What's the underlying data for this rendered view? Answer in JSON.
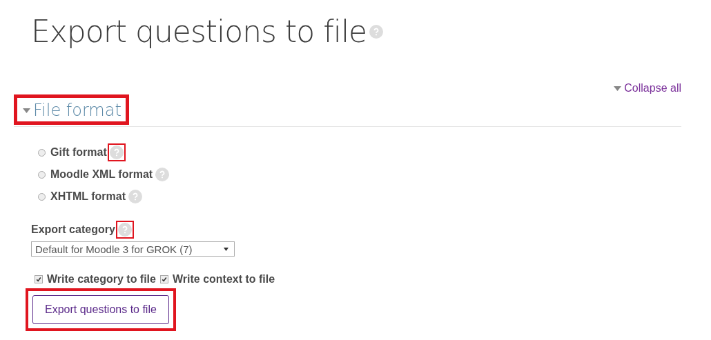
{
  "page_title": "Export questions to file",
  "collapse_all": {
    "label": "Collapse all"
  },
  "section": {
    "title": "File format",
    "expanded": true,
    "highlighted": true
  },
  "formats": [
    {
      "label": "Gift format",
      "selected": false,
      "help_highlighted": true
    },
    {
      "label": "Moodle XML format",
      "selected": false,
      "help_highlighted": false
    },
    {
      "label": "XHTML format",
      "selected": false,
      "help_highlighted": false
    }
  ],
  "category": {
    "label": "Export category",
    "help_highlighted": true,
    "value": "Default for Moodle 3 for GROK (7)"
  },
  "options": [
    {
      "label": "Write category to file",
      "checked": true
    },
    {
      "label": "Write context to file",
      "checked": true
    }
  ],
  "submit": {
    "label": "Export questions to file",
    "highlighted": true
  }
}
